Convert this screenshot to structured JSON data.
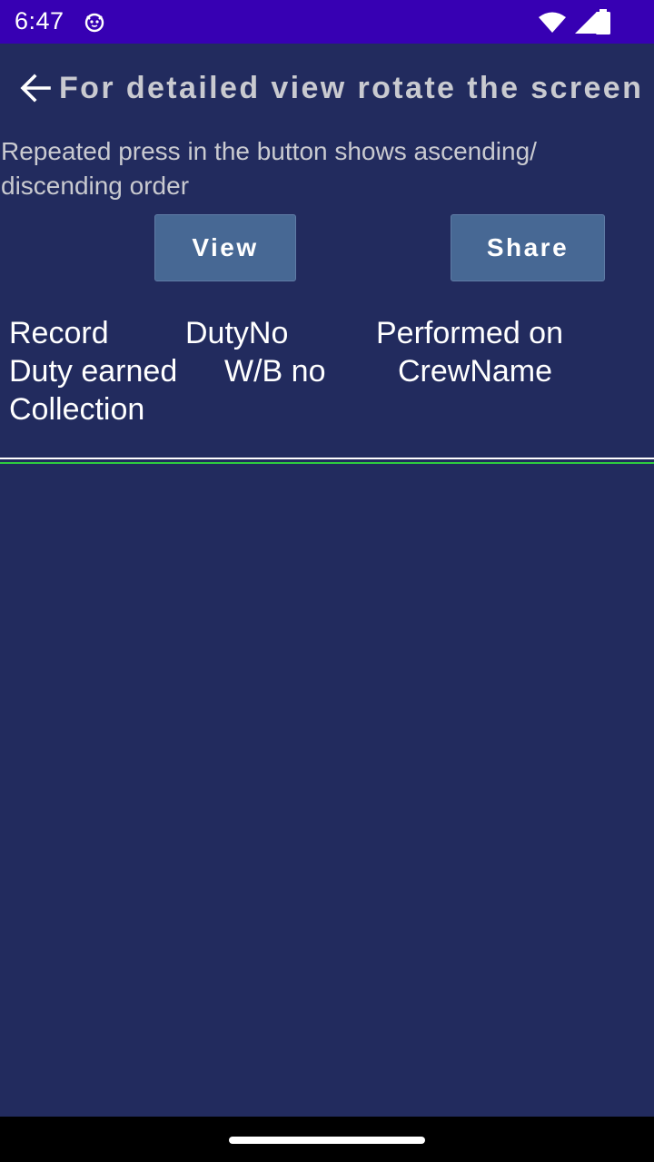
{
  "status_bar": {
    "time": "6:47",
    "app_icon": "cat-face-icon",
    "icons": [
      "wifi-icon",
      "signal-icon",
      "battery-icon"
    ]
  },
  "header": {
    "title": "For detailed view rotate the screen",
    "back_icon": "arrow-left-icon"
  },
  "hint": "Repeated press in the button shows ascending/ discending order",
  "buttons": {
    "view_label": "View",
    "share_label": "Share"
  },
  "table": {
    "columns": [
      "Record",
      "DutyNo",
      "Performed on",
      "Duty earned",
      "W/B no",
      "CrewName",
      "Collection"
    ]
  },
  "colors": {
    "status_bar": "#3700b3",
    "background": "#222b5e",
    "button": "#476894",
    "divider_accent": "#2ecc40"
  }
}
